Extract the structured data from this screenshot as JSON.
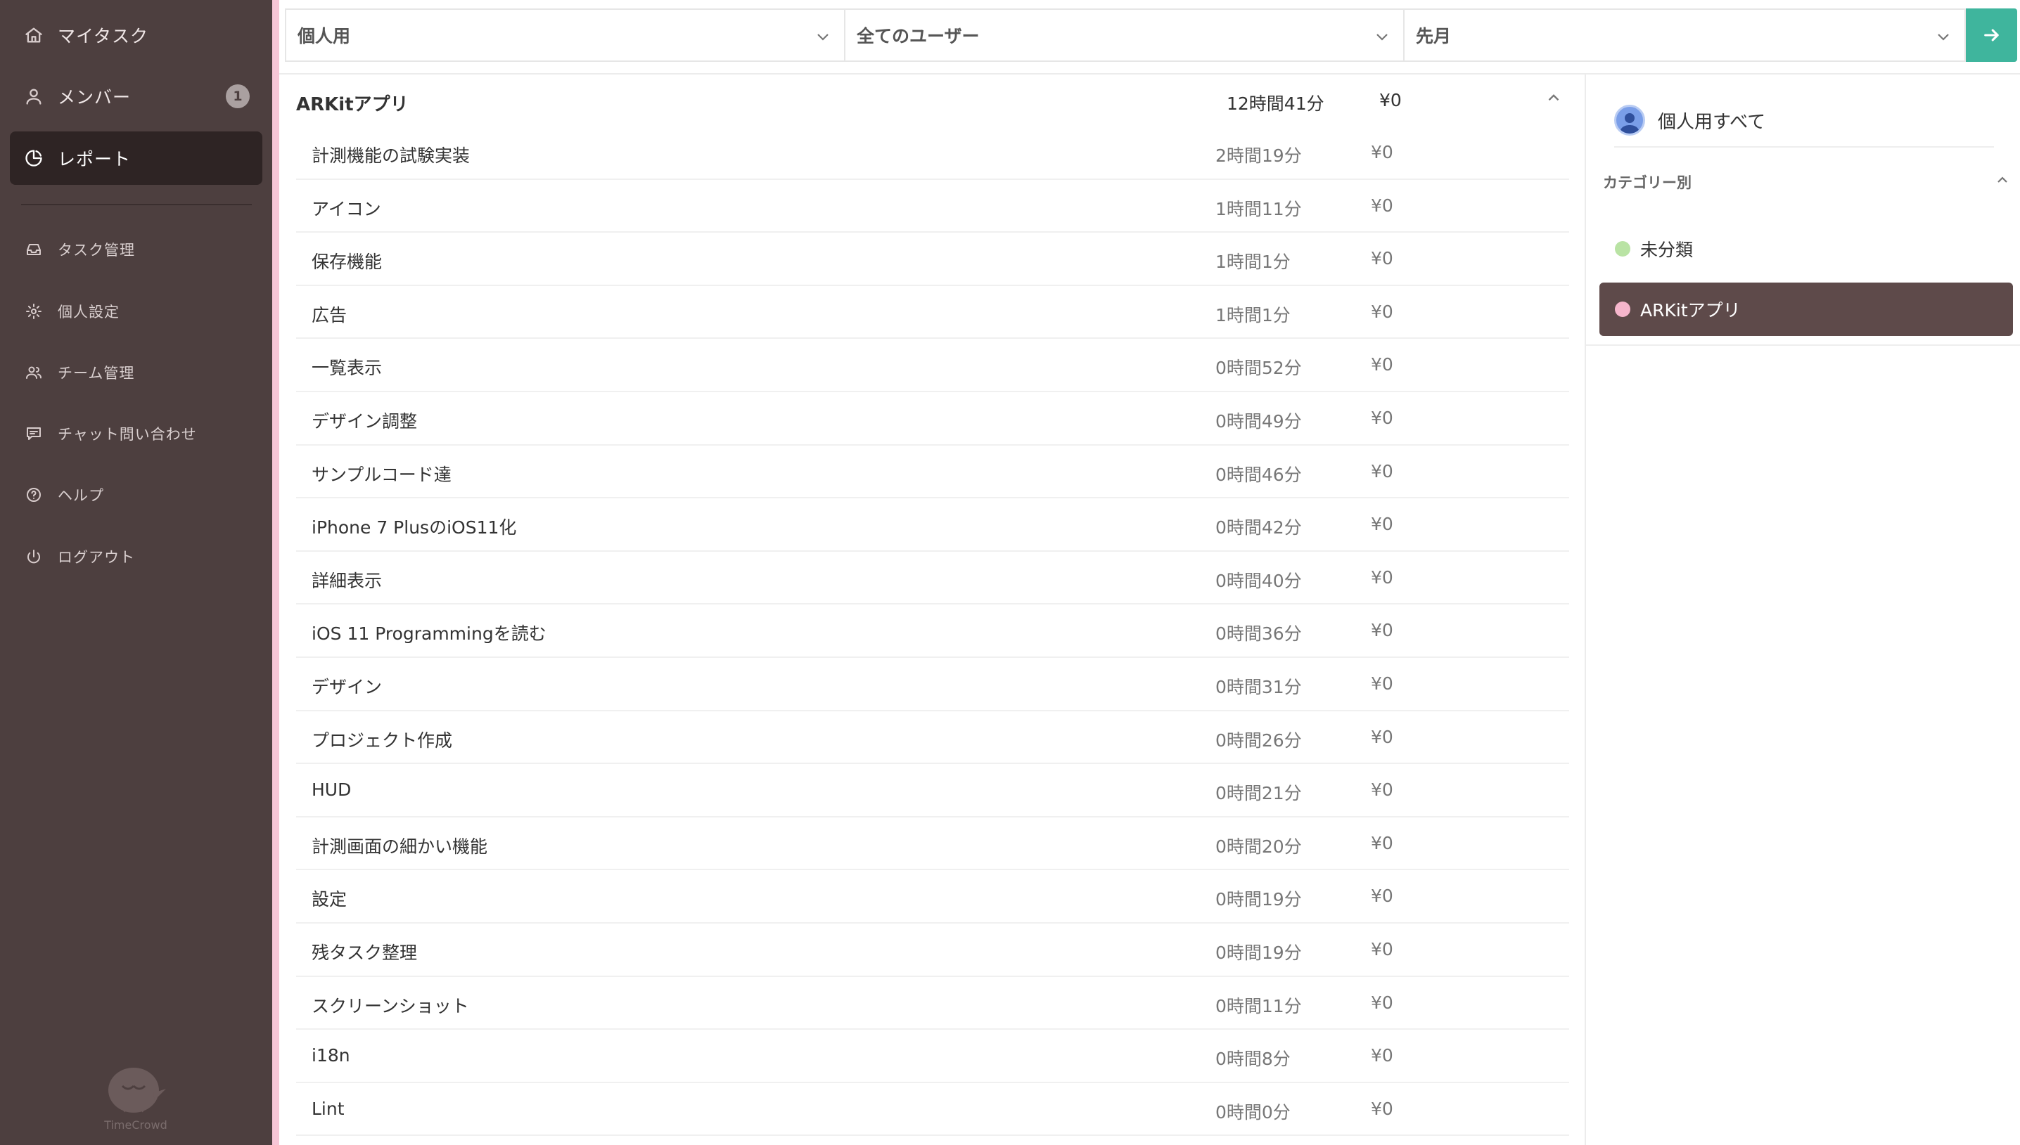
{
  "sidebar": {
    "items": [
      {
        "label": "マイタスク",
        "icon": "home-icon"
      },
      {
        "label": "メンバー",
        "icon": "user-icon",
        "badge": "1"
      },
      {
        "label": "レポート",
        "icon": "report-icon",
        "active": true
      },
      {
        "label": "タスク管理",
        "icon": "inbox-icon"
      },
      {
        "label": "個人設定",
        "icon": "gear-icon"
      },
      {
        "label": "チーム管理",
        "icon": "team-icon"
      },
      {
        "label": "チャット問い合わせ",
        "icon": "chat-icon"
      },
      {
        "label": "ヘルプ",
        "icon": "help-icon"
      },
      {
        "label": "ログアウト",
        "icon": "power-icon"
      }
    ],
    "logo_text": "TimeCrowd"
  },
  "filters": {
    "team": "個人用",
    "user": "全てのユーザー",
    "period": "先月"
  },
  "report": {
    "group": {
      "name": "ARKitアプリ",
      "time": "12時間41分",
      "cost": "¥0"
    },
    "rows": [
      {
        "name": "計測機能の試験実装",
        "time": "2時間19分",
        "cost": "¥0"
      },
      {
        "name": "アイコン",
        "time": "1時間11分",
        "cost": "¥0"
      },
      {
        "name": "保存機能",
        "time": "1時間1分",
        "cost": "¥0"
      },
      {
        "name": "広告",
        "time": "1時間1分",
        "cost": "¥0"
      },
      {
        "name": "一覧表示",
        "time": "0時間52分",
        "cost": "¥0"
      },
      {
        "name": "デザイン調整",
        "time": "0時間49分",
        "cost": "¥0"
      },
      {
        "name": "サンプルコード達",
        "time": "0時間46分",
        "cost": "¥0"
      },
      {
        "name": "iPhone 7 PlusのiOS11化",
        "time": "0時間42分",
        "cost": "¥0"
      },
      {
        "name": "詳細表示",
        "time": "0時間40分",
        "cost": "¥0"
      },
      {
        "name": "iOS 11 Programmingを読む",
        "time": "0時間36分",
        "cost": "¥0"
      },
      {
        "name": "デザイン",
        "time": "0時間31分",
        "cost": "¥0"
      },
      {
        "name": "プロジェクト作成",
        "time": "0時間26分",
        "cost": "¥0"
      },
      {
        "name": "HUD",
        "time": "0時間21分",
        "cost": "¥0"
      },
      {
        "name": "計測画面の細かい機能",
        "time": "0時間20分",
        "cost": "¥0"
      },
      {
        "name": "設定",
        "time": "0時間19分",
        "cost": "¥0"
      },
      {
        "name": "残タスク整理",
        "time": "0時間19分",
        "cost": "¥0"
      },
      {
        "name": "スクリーンショット",
        "time": "0時間11分",
        "cost": "¥0"
      },
      {
        "name": "i18n",
        "time": "0時間8分",
        "cost": "¥0"
      },
      {
        "name": "Lint",
        "time": "0時間0分",
        "cost": "¥0"
      }
    ]
  },
  "right_panel": {
    "all_label": "個人用すべて",
    "category_header": "カテゴリー別",
    "categories": [
      {
        "label": "未分類",
        "color": "#b9e3a4"
      },
      {
        "label": "ARKitアプリ",
        "color": "#f6b6cc",
        "selected": true
      }
    ]
  },
  "colors": {
    "sidebar_bg": "#4d3f3f",
    "accent": "#3fb59d",
    "category_pink": "#f6c6d6"
  }
}
